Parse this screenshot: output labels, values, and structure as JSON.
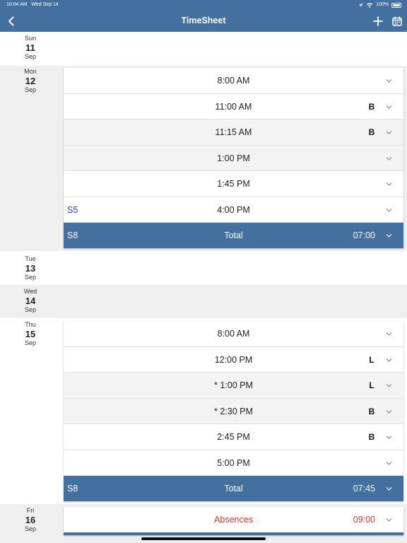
{
  "status": {
    "time": "10:04 AM",
    "date": "Wed Sep 14",
    "battery": "100%"
  },
  "nav": {
    "title": "TimeSheet"
  },
  "colors": {
    "accent": "#44709f",
    "absence": "#e1392b",
    "shift_link": "#2d43c4"
  },
  "days": [
    {
      "dow": "Sun",
      "num": "11",
      "mon": "Sep"
    },
    {
      "dow": "Mon",
      "num": "12",
      "mon": "Sep"
    },
    {
      "dow": "Tue",
      "num": "13",
      "mon": "Sep"
    },
    {
      "dow": "Wed",
      "num": "14",
      "mon": "Sep"
    },
    {
      "dow": "Thu",
      "num": "15",
      "mon": "Sep"
    },
    {
      "dow": "Fri",
      "num": "16",
      "mon": "Sep"
    }
  ],
  "mon_entries": [
    {
      "time": "8:00 AM",
      "tag": "",
      "shift": ""
    },
    {
      "time": "11:00 AM",
      "tag": "B",
      "shift": ""
    },
    {
      "time": "11:15 AM",
      "tag": "B",
      "shift": ""
    },
    {
      "time": "1:00 PM",
      "tag": "",
      "shift": ""
    },
    {
      "time": "1:45 PM",
      "tag": "",
      "shift": ""
    },
    {
      "time": "4:00 PM",
      "tag": "",
      "shift": "S5"
    }
  ],
  "mon_total": {
    "shift": "S8",
    "label": "Total",
    "hours": "07:00"
  },
  "thu_entries": [
    {
      "time": "8:00 AM",
      "tag": "",
      "shift": ""
    },
    {
      "time": "12:00 PM",
      "tag": "L",
      "shift": ""
    },
    {
      "time": "* 1:00 PM",
      "tag": "L",
      "shift": ""
    },
    {
      "time": "* 2:30 PM",
      "tag": "B",
      "shift": ""
    },
    {
      "time": "2:45 PM",
      "tag": "B",
      "shift": ""
    },
    {
      "time": "5:00 PM",
      "tag": "",
      "shift": ""
    }
  ],
  "thu_total": {
    "shift": "S8",
    "label": "Total",
    "hours": "07:45"
  },
  "fri_absence": {
    "label": "Absences",
    "hours": "09:00"
  }
}
